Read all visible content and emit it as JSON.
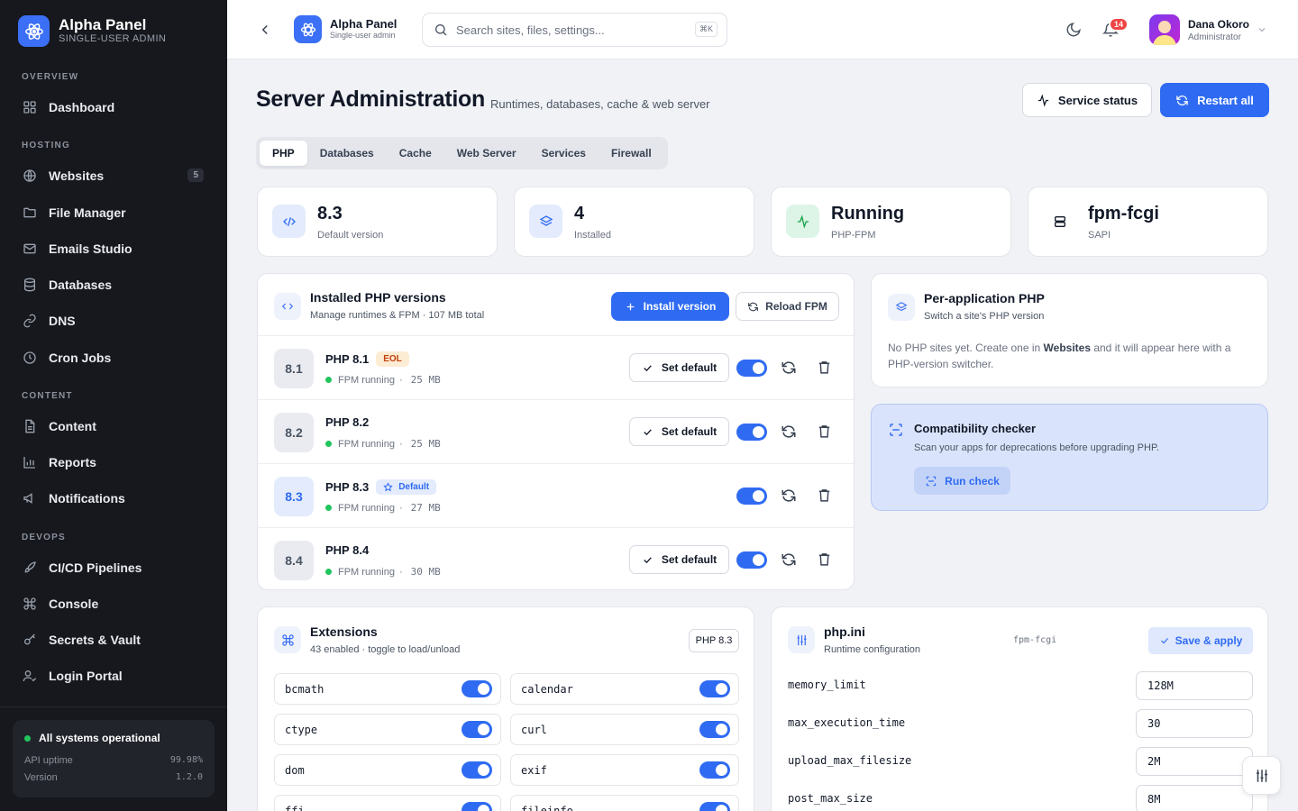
{
  "sidebar": {
    "brand_title": "Alpha Panel",
    "brand_sub": "SINGLE-USER ADMIN",
    "sections": {
      "overview": "OVERVIEW",
      "hosting": "HOSTING",
      "content": "CONTENT",
      "devops": "DEVOPS"
    },
    "items": [
      {
        "label": "Dashboard",
        "icon": "grid-icon"
      },
      {
        "label": "Websites",
        "icon": "globe-icon",
        "badge": "5"
      },
      {
        "label": "File Manager",
        "icon": "folder-icon"
      },
      {
        "label": "Emails Studio",
        "icon": "mail-icon"
      },
      {
        "label": "Databases",
        "icon": "database-icon"
      },
      {
        "label": "DNS",
        "icon": "dns-icon"
      },
      {
        "label": "Cron Jobs",
        "icon": "clock-icon"
      },
      {
        "label": "Content",
        "icon": "file-icon"
      },
      {
        "label": "Reports",
        "icon": "bar-chart-icon"
      },
      {
        "label": "Notifications",
        "icon": "megaphone-icon"
      },
      {
        "label": "CI/CD Pipelines",
        "icon": "rocket-icon"
      },
      {
        "label": "Console",
        "icon": "command-icon"
      },
      {
        "label": "Secrets & Vault",
        "icon": "key-icon"
      },
      {
        "label": "Login Portal",
        "icon": "user-check-icon"
      }
    ],
    "status": {
      "title": "All systems operational",
      "uptime_label": "API uptime",
      "uptime_value": "99.98%",
      "version_label": "Version",
      "version_value": "1.2.0"
    }
  },
  "topbar": {
    "brand_title": "Alpha Panel",
    "brand_sub": "Single-user admin",
    "search_placeholder": "Search sites, files, settings...",
    "search_shortcut": "⌘K",
    "notifications_count": "14",
    "user_name": "Dana Okoro",
    "user_role": "Administrator"
  },
  "header": {
    "title": "Server Administration",
    "subtitle": "Runtimes, databases, cache & web server",
    "service_status_label": "Service status",
    "restart_all_label": "Restart all"
  },
  "tabs": [
    "PHP",
    "Databases",
    "Cache",
    "Web Server",
    "Services",
    "Firewall"
  ],
  "stats": [
    {
      "value": "8.3",
      "label": "Default version",
      "icon": "code-icon"
    },
    {
      "value": "4",
      "label": "Installed",
      "icon": "layers-icon"
    },
    {
      "value": "Running",
      "label": "PHP-FPM",
      "icon": "activity-icon"
    },
    {
      "value": "fpm-fcgi",
      "label": "SAPI",
      "icon": "server-icon"
    }
  ],
  "php_versions": {
    "title": "Installed PHP versions",
    "subtitle": "Manage runtimes & FPM · 107 MB total",
    "install_label": "Install version",
    "reload_label": "Reload FPM",
    "set_default_label": "Set default",
    "rows": [
      {
        "short": "8.1",
        "name": "PHP 8.1",
        "badge": "EOL",
        "status": "FPM running",
        "size": "25 MB",
        "enabled": true
      },
      {
        "short": "8.2",
        "name": "PHP 8.2",
        "status": "FPM running",
        "size": "25 MB",
        "enabled": true
      },
      {
        "short": "8.3",
        "name": "PHP 8.3",
        "badge": "Default",
        "status": "FPM running",
        "size": "27 MB",
        "enabled": true
      },
      {
        "short": "8.4",
        "name": "PHP 8.4",
        "status": "FPM running",
        "size": "30 MB",
        "enabled": true
      }
    ]
  },
  "per_app": {
    "title": "Per-application PHP",
    "subtitle": "Switch a site's PHP version",
    "text_before": "No PHP sites yet. Create one in ",
    "link": "Websites",
    "text_after": " and it will appear here with a PHP-version switcher."
  },
  "compat": {
    "title": "Compatibility checker",
    "subtitle": "Scan your apps for deprecations before upgrading PHP.",
    "button": "Run check"
  },
  "extensions": {
    "title": "Extensions",
    "subtitle": "43 enabled · toggle to load/unload",
    "version_select": "PHP 8.3",
    "items": [
      {
        "name": "bcmath",
        "enabled": true
      },
      {
        "name": "calendar",
        "enabled": true
      },
      {
        "name": "ctype",
        "enabled": true
      },
      {
        "name": "curl",
        "enabled": true
      },
      {
        "name": "dom",
        "enabled": true
      },
      {
        "name": "exif",
        "enabled": true
      },
      {
        "name": "ffi",
        "enabled": true
      },
      {
        "name": "fileinfo",
        "enabled": true
      }
    ]
  },
  "phpini": {
    "title": "php.ini",
    "subtitle": "Runtime configuration",
    "sapi": "fpm-fcgi",
    "save_label": "Save & apply",
    "settings": [
      {
        "key": "memory_limit",
        "value": "128M"
      },
      {
        "key": "max_execution_time",
        "value": "30"
      },
      {
        "key": "upload_max_filesize",
        "value": "2M"
      },
      {
        "key": "post_max_size",
        "value": "8M"
      }
    ]
  },
  "colors": {
    "accent": "#2f6bf2",
    "sidebar_bg": "#16181d",
    "success": "#22c55e",
    "danger": "#ef4444",
    "eol": "#c2410c"
  }
}
